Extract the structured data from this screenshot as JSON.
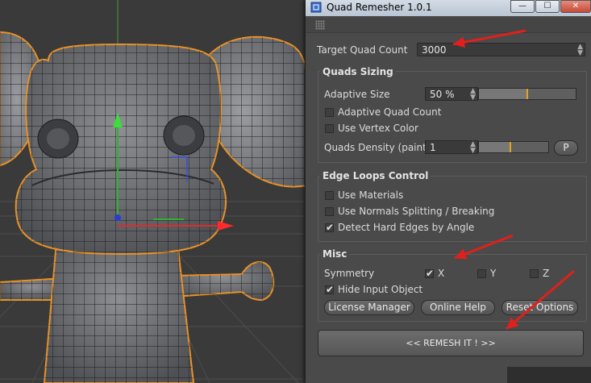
{
  "window": {
    "title": "Quad Remesher 1.0.1",
    "min_glyph": "—",
    "max_glyph": "☐",
    "close_glyph": "✕"
  },
  "main": {
    "target_quad_count_label": "Target Quad Count",
    "target_quad_count_value": "3000"
  },
  "quads_sizing": {
    "title": "Quads Sizing",
    "adaptive_size_label": "Adaptive Size",
    "adaptive_size_value": "50 %",
    "adaptive_size_level": 0.5,
    "adaptive_quad_count_label": "Adaptive Quad Count",
    "adaptive_quad_count_checked": false,
    "use_vertex_color_label": "Use Vertex Color",
    "use_vertex_color_checked": false,
    "quads_density_label": "Quads Density (paint)",
    "quads_density_value": "1",
    "quads_density_level": 0.45,
    "p_button_label": "P"
  },
  "edge_loops": {
    "title": "Edge Loops Control",
    "use_materials_label": "Use Materials",
    "use_materials_checked": false,
    "use_normals_label": "Use Normals Splitting / Breaking",
    "use_normals_checked": false,
    "detect_hard_edges_label": "Detect Hard Edges by Angle",
    "detect_hard_edges_checked": true
  },
  "misc": {
    "title": "Misc",
    "symmetry_label": "Symmetry",
    "x_label": "X",
    "x_checked": true,
    "y_label": "Y",
    "y_checked": false,
    "z_label": "Z",
    "z_checked": false,
    "hide_input_label": "Hide Input Object",
    "hide_input_checked": true,
    "license_manager_label": "License Manager",
    "online_help_label": "Online Help",
    "reset_options_label": "Reset Options"
  },
  "remesh_label": "<<   REMESH IT !   >>",
  "check_glyph": "✔",
  "colors": {
    "annotation_arrow": "#e0201c",
    "accent_knob": "#e8a020",
    "model_wire": "#1e1e1e",
    "model_outline": "#e8922a"
  }
}
